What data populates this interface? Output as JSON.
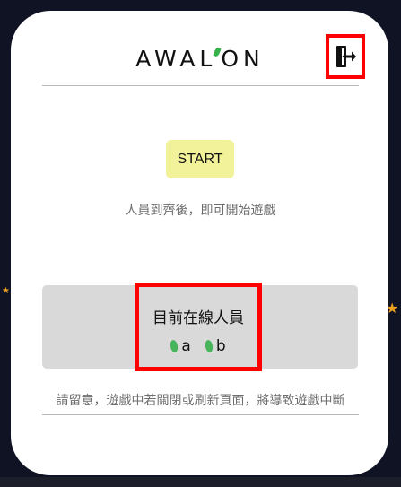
{
  "header": {
    "logo_text": "AWAL'ON",
    "exit_icon": "door-exit-icon"
  },
  "main": {
    "start_label": "START",
    "hint": "人員到齊後，即可開始遊戲"
  },
  "online": {
    "title": "目前在線人員",
    "players": [
      {
        "name": "a",
        "icon": "leaf-icon"
      },
      {
        "name": "b",
        "icon": "leaf-icon"
      }
    ]
  },
  "footer": {
    "warning": "請留意，遊戲中若關閉或刷新頁面，將導致遊戲中斷"
  },
  "colors": {
    "background": "#0f1324",
    "card": "#ffffff",
    "start_button": "#f2f29a",
    "panel": "#d9d9d9",
    "highlight": "#ff0000",
    "leaf": "#47b35a"
  }
}
